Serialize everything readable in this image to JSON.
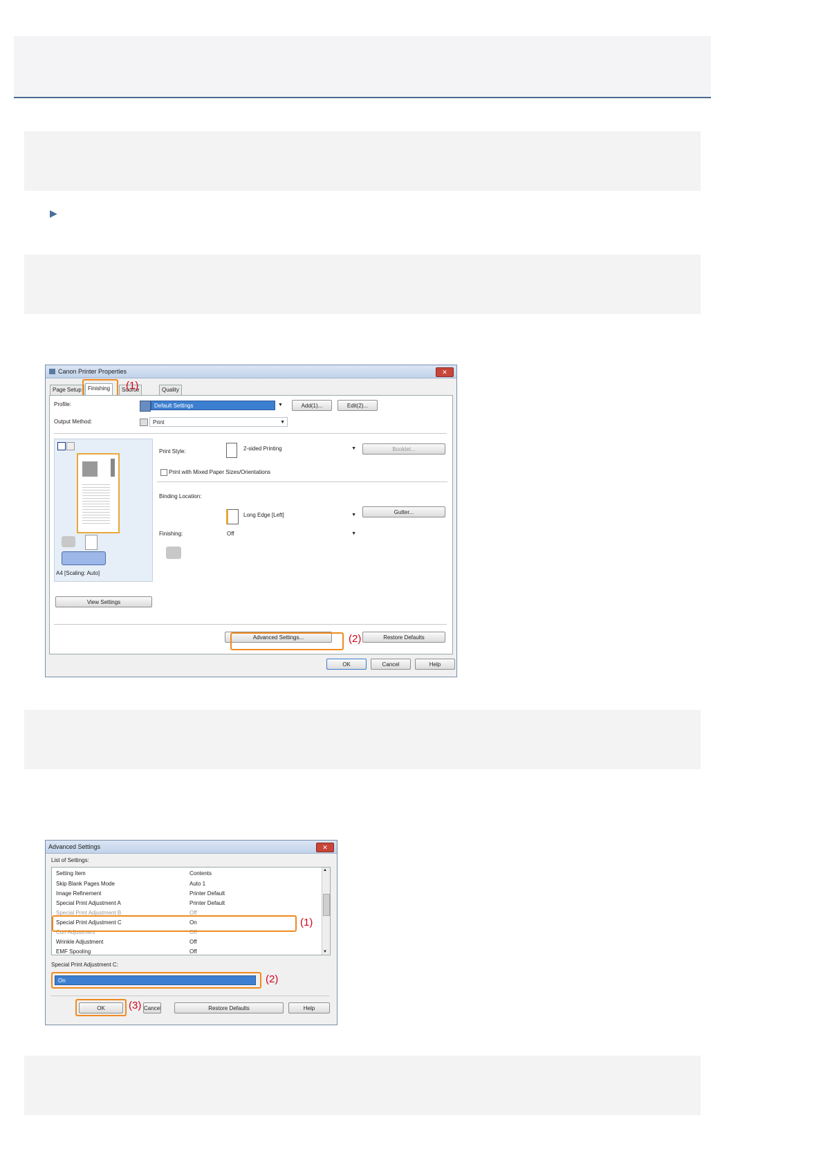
{
  "dialog1": {
    "title": "Canon Printer Properties",
    "close": "✕",
    "tabs": [
      "Page Setup",
      "Finishing",
      "Source",
      "Quality"
    ],
    "profile_label": "Profile:",
    "profile_value": "Default Settings",
    "add_button": "Add(1)...",
    "edit_button": "Edit(2)...",
    "output_method_label": "Output Method:",
    "output_method_value": "Print",
    "print_style_label": "Print Style:",
    "print_style_value": "2-sided Printing",
    "booklet_button": "Booklet...",
    "mixed_paper_label": "Print with Mixed Paper Sizes/Orientations",
    "binding_location_label": "Binding Location:",
    "binding_location_value": "Long Edge [Left]",
    "gutter_button": "Gutter...",
    "finishing_label": "Finishing:",
    "finishing_value": "Off",
    "preview_caption": "A4 [Scaling: Auto]",
    "view_settings_button": "View Settings",
    "advanced_settings_button": "Advanced Settings...",
    "restore_defaults_button": "Restore Defaults",
    "ok_button": "OK",
    "cancel_button": "Cancel",
    "help_button": "Help",
    "callout1": "(1)",
    "callout2": "(2)"
  },
  "dialog2": {
    "title": "Advanced Settings",
    "close": "✕",
    "list_label": "List of Settings:",
    "col_item": "Setting Item",
    "col_contents": "Contents",
    "rows": [
      {
        "item": "Skip Blank Pages Mode",
        "value": "Auto 1"
      },
      {
        "item": "Image Refinement",
        "value": "Printer Default"
      },
      {
        "item": "Special Print Adjustment A",
        "value": "Printer Default"
      },
      {
        "item": "Special Print Adjustment B",
        "value": "Off"
      },
      {
        "item": "Special Print Adjustment C",
        "value": "On"
      },
      {
        "item": "Curl Adjustment",
        "value": "Off"
      },
      {
        "item": "Wrinkle Adjustment",
        "value": "Off"
      },
      {
        "item": "EMF Spooling",
        "value": "Off"
      }
    ],
    "selected_label": "Special Print Adjustment C:",
    "selected_value": "On",
    "ok_button": "OK",
    "cancel_button": "Cancel",
    "restore_defaults_button": "Restore Defaults",
    "help_button": "Help",
    "callout1": "(1)",
    "callout2": "(2)",
    "callout3": "(3)"
  }
}
